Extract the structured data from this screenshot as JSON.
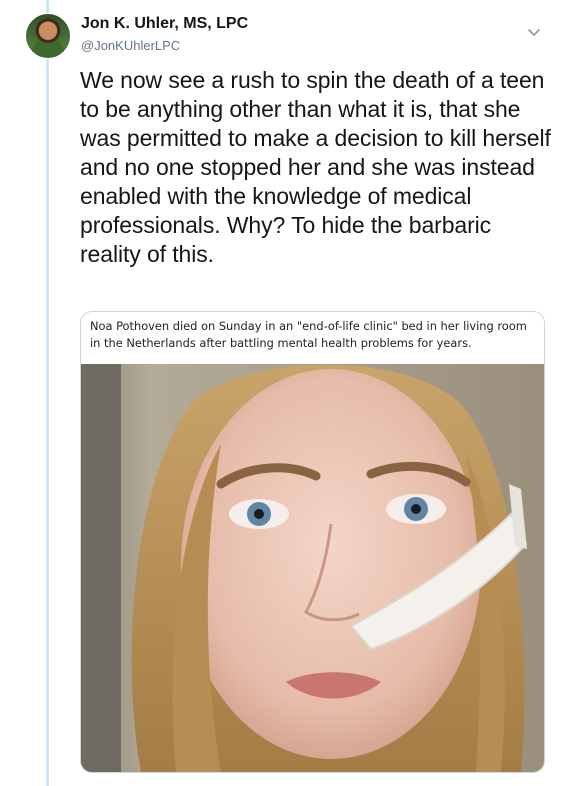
{
  "tweet": {
    "author_name": "Jon K. Uhler, MS, LPC",
    "author_handle": "@JonKUhlerLPC",
    "text": "We now see a rush to spin the death of a teen to be anything other than what it is, that she was permitted to make a decision to kill herself and no one stopped her and she was instead enabled with the knowledge of medical professionals. Why? To hide the barbaric reality of this."
  },
  "card": {
    "caption": "Noa Pothoven died on Sunday in an \"end-of-life clinic\" bed in her living room in the Netherlands after battling mental health problems for years."
  },
  "icons": {
    "avatar": "avatar-photo",
    "caret": "chevron-down-icon"
  },
  "colors": {
    "thread_line": "#cce4f6",
    "secondary_text": "#657786",
    "card_border": "#ccd6dd"
  }
}
